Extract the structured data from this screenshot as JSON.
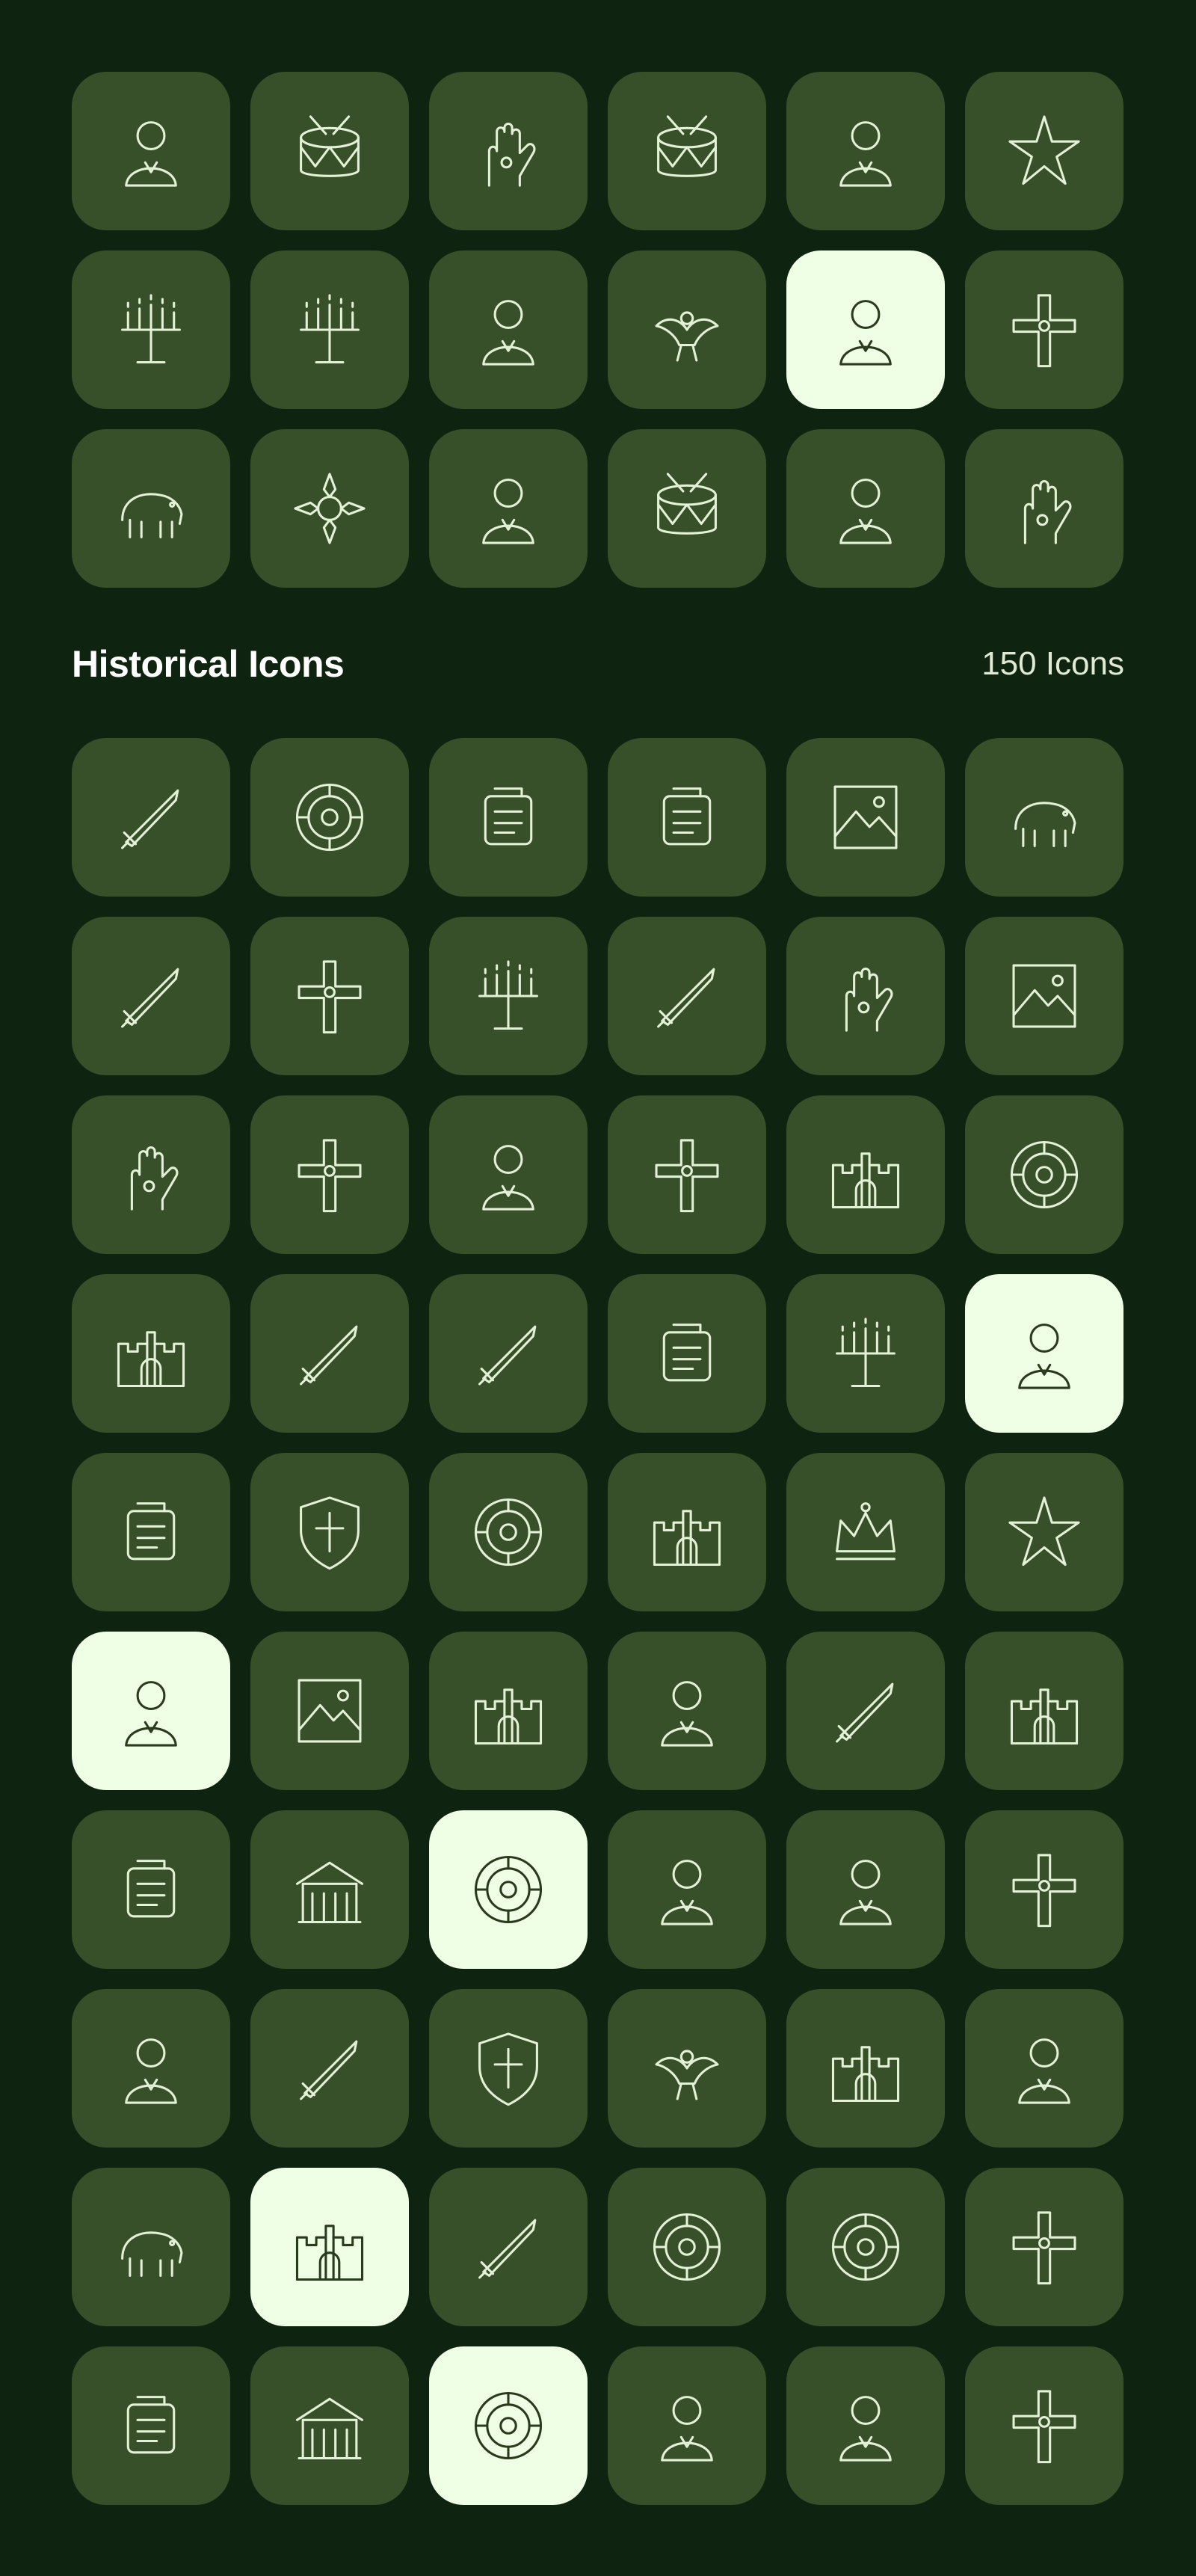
{
  "section": {
    "title": "Historical Icons",
    "count": "150 Icons"
  },
  "colors": {
    "background": "#0f2410",
    "tile": "#38502a",
    "tile_highlight": "#efffe6",
    "stroke": "#e3f1d6",
    "stroke_highlight": "#283b1d"
  },
  "top_grid": [
    {
      "icon": "matryoshka-doll-icon",
      "hl": false
    },
    {
      "icon": "samovar-icon",
      "hl": false
    },
    {
      "icon": "hand-holding-corn-icon",
      "hl": false
    },
    {
      "icon": "drum-icon",
      "hl": false
    },
    {
      "icon": "asian-woman-headdress-icon",
      "hl": false
    },
    {
      "icon": "lotus-lantern-icon",
      "hl": false
    },
    {
      "icon": "firecrackers-icon",
      "hl": false
    },
    {
      "icon": "menorah-icon",
      "hl": false
    },
    {
      "icon": "christ-the-redeemer-icon",
      "hl": false
    },
    {
      "icon": "toucan-icon",
      "hl": false
    },
    {
      "icon": "man-portrait-icon",
      "hl": true
    },
    {
      "icon": "crossed-swords-icon",
      "hl": false
    },
    {
      "icon": "bull-head-icon",
      "hl": false
    },
    {
      "icon": "necklace-icon",
      "hl": false
    },
    {
      "icon": "native-headdress-portrait-icon",
      "hl": false
    },
    {
      "icon": "teapot-pouring-icon",
      "hl": false
    },
    {
      "icon": "woman-headscarf-portrait-icon",
      "hl": false
    },
    {
      "icon": "hand-fan-icon",
      "hl": false
    }
  ],
  "main_grid": [
    {
      "icon": "warrior-with-spear-icon",
      "hl": false
    },
    {
      "icon": "evil-eye-icon",
      "hl": false
    },
    {
      "icon": "spartan-helmet-icon",
      "hl": false
    },
    {
      "icon": "embroidered-shirt-icon",
      "hl": false
    },
    {
      "icon": "tapestry-banner-icon",
      "hl": false
    },
    {
      "icon": "mammoth-icon",
      "hl": false
    },
    {
      "icon": "sword-icon",
      "hl": false
    },
    {
      "icon": "ankh-icon",
      "hl": false
    },
    {
      "icon": "candelabra-icon",
      "hl": false
    },
    {
      "icon": "double-axe-icon",
      "hl": false
    },
    {
      "icon": "gauntlets-icon",
      "hl": false
    },
    {
      "icon": "cave-icon",
      "hl": false
    },
    {
      "icon": "hamsa-hand-icon",
      "hl": false
    },
    {
      "icon": "ornate-cross-icon",
      "hl": false
    },
    {
      "icon": "statue-on-pedestal-icon",
      "hl": false
    },
    {
      "icon": "celtic-cross-icon",
      "hl": false
    },
    {
      "icon": "palace-icon",
      "hl": false
    },
    {
      "icon": "star-of-david-emblem-icon",
      "hl": false
    },
    {
      "icon": "city-buildings-icon",
      "hl": false
    },
    {
      "icon": "quiver-arrows-icon",
      "hl": false
    },
    {
      "icon": "antlers-arrow-icon",
      "hl": false
    },
    {
      "icon": "bagpipes-icon",
      "hl": false
    },
    {
      "icon": "lantern-icon",
      "hl": false
    },
    {
      "icon": "viking-warrior-icon",
      "hl": true
    },
    {
      "icon": "boots-icon",
      "hl": false
    },
    {
      "icon": "heraldic-shield-icon",
      "hl": false
    },
    {
      "icon": "celtic-knot-icon",
      "hl": false
    },
    {
      "icon": "castle-icon",
      "hl": false
    },
    {
      "icon": "royal-crown-icon",
      "hl": false
    },
    {
      "icon": "fleur-de-lis-icon",
      "hl": false
    },
    {
      "icon": "king-portrait-icon",
      "hl": true
    },
    {
      "icon": "framed-landscape-icon",
      "hl": false
    },
    {
      "icon": "tower-bridge-icon",
      "hl": false
    },
    {
      "icon": "aztec-mask-icon",
      "hl": false
    },
    {
      "icon": "knight-with-sword-shield-icon",
      "hl": false
    },
    {
      "icon": "pagoda-icon",
      "hl": false
    },
    {
      "icon": "royal-carriage-icon",
      "hl": false
    },
    {
      "icon": "classical-building-icon",
      "hl": false
    },
    {
      "icon": "aztec-calendar-icon",
      "hl": true
    },
    {
      "icon": "warrior-helmet-portrait-icon",
      "hl": false
    },
    {
      "icon": "statue-monument-icon",
      "hl": false
    },
    {
      "icon": "ornamental-cross-icon",
      "hl": false
    },
    {
      "icon": "nobleman-portrait-icon",
      "hl": false
    },
    {
      "icon": "bow-and-arrow-icon",
      "hl": false
    },
    {
      "icon": "viking-shield-icon",
      "hl": false
    },
    {
      "icon": "scarab-beetle-icon",
      "hl": false
    },
    {
      "icon": "temple-complex-icon",
      "hl": false
    },
    {
      "icon": "native-chief-icon",
      "hl": false
    },
    {
      "icon": "pegasus-icon",
      "hl": false
    },
    {
      "icon": "cathedral-icon",
      "hl": true
    },
    {
      "icon": "war-hammer-icon",
      "hl": false
    },
    {
      "icon": "eagle-emblem-icon",
      "hl": false
    },
    {
      "icon": "compass-rose-icon",
      "hl": false
    },
    {
      "icon": "cross-shield-icon",
      "hl": false
    },
    {
      "icon": "royal-carriage-icon",
      "hl": false
    },
    {
      "icon": "classical-building-icon",
      "hl": false
    },
    {
      "icon": "aztec-calendar-icon",
      "hl": true
    },
    {
      "icon": "warrior-helmet-portrait-icon",
      "hl": false
    },
    {
      "icon": "statue-monument-icon",
      "hl": false
    },
    {
      "icon": "ornamental-cross-icon",
      "hl": false
    }
  ]
}
